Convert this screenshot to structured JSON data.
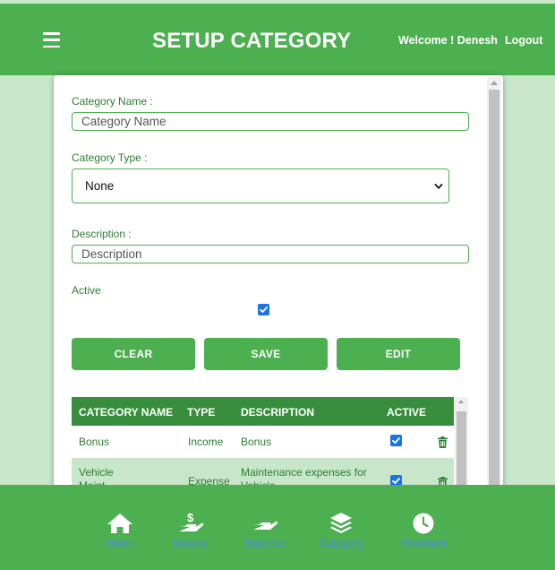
{
  "header": {
    "title": "SETUP CATEGORY",
    "welcome": "Welcome ! Denesh",
    "logout": "Logout"
  },
  "form": {
    "category_name_label": "Category Name :",
    "category_name_placeholder": "Category Name",
    "category_type_label": "Category Type :",
    "category_type_selected": "None",
    "description_label": "Description :",
    "description_placeholder": "Description",
    "active_label": "Active",
    "active_checked": true
  },
  "buttons": {
    "clear": "CLEAR",
    "save": "SAVE",
    "edit": "EDIT"
  },
  "table": {
    "columns": [
      "CATEGORY NAME",
      "TYPE",
      "DESCRIPTION",
      "ACTIVE"
    ],
    "rows": [
      {
        "name": "Bonus",
        "type": "Income",
        "description": "Bonus",
        "active": true
      },
      {
        "name_line1": "Vehicle",
        "name_line2": "Maint...",
        "type": "Expense",
        "description_line1": "Maintenance expenses for",
        "description_line2": "Vehicle",
        "active": true
      }
    ]
  },
  "bottom_nav": {
    "items": [
      {
        "label": "Home",
        "icon": "home-icon"
      },
      {
        "label": "Income",
        "icon": "income-icon"
      },
      {
        "label": "Expense",
        "icon": "expense-icon"
      },
      {
        "label": "Category",
        "icon": "layers-icon"
      },
      {
        "label": "Reminder",
        "icon": "clock-icon"
      }
    ]
  },
  "colors": {
    "primary": "#4caf50",
    "primary_dark": "#388e3c",
    "background": "#c8e6c9",
    "nav_label": "#4f8cf0",
    "checkbox": "#1a73e8"
  }
}
